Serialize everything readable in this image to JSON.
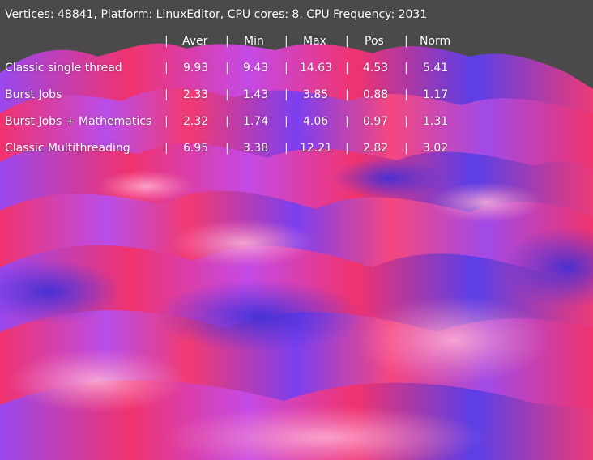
{
  "header": {
    "stats_line": "Vertices: 48841, Platform: LinuxEditor, CPU cores: 8, CPU Frequency: 2031"
  },
  "table": {
    "separator": "|",
    "columns": [
      "Aver",
      "Min",
      "Max",
      "Pos",
      "Norm"
    ],
    "rows": [
      {
        "name": "Classic single thread",
        "values": [
          "9.93",
          "9.43",
          "14.63",
          "4.53",
          "5.41"
        ]
      },
      {
        "name": "Burst Jobs",
        "values": [
          "2.33",
          "1.43",
          "3.85",
          "0.88",
          "1.17"
        ]
      },
      {
        "name": "Burst Jobs + Mathematics",
        "values": [
          "2.32",
          "1.74",
          "4.06",
          "0.97",
          "1.31"
        ]
      },
      {
        "name": "Classic Multithreading",
        "values": [
          "6.95",
          "3.38",
          "12.21",
          "2.82",
          "3.02"
        ]
      }
    ]
  },
  "colors": {
    "background": "#4a4a4a",
    "surface_pink": "#f0336e",
    "surface_violet": "#8c46f0",
    "surface_blue": "#5040e6",
    "text": "#ffffff"
  }
}
